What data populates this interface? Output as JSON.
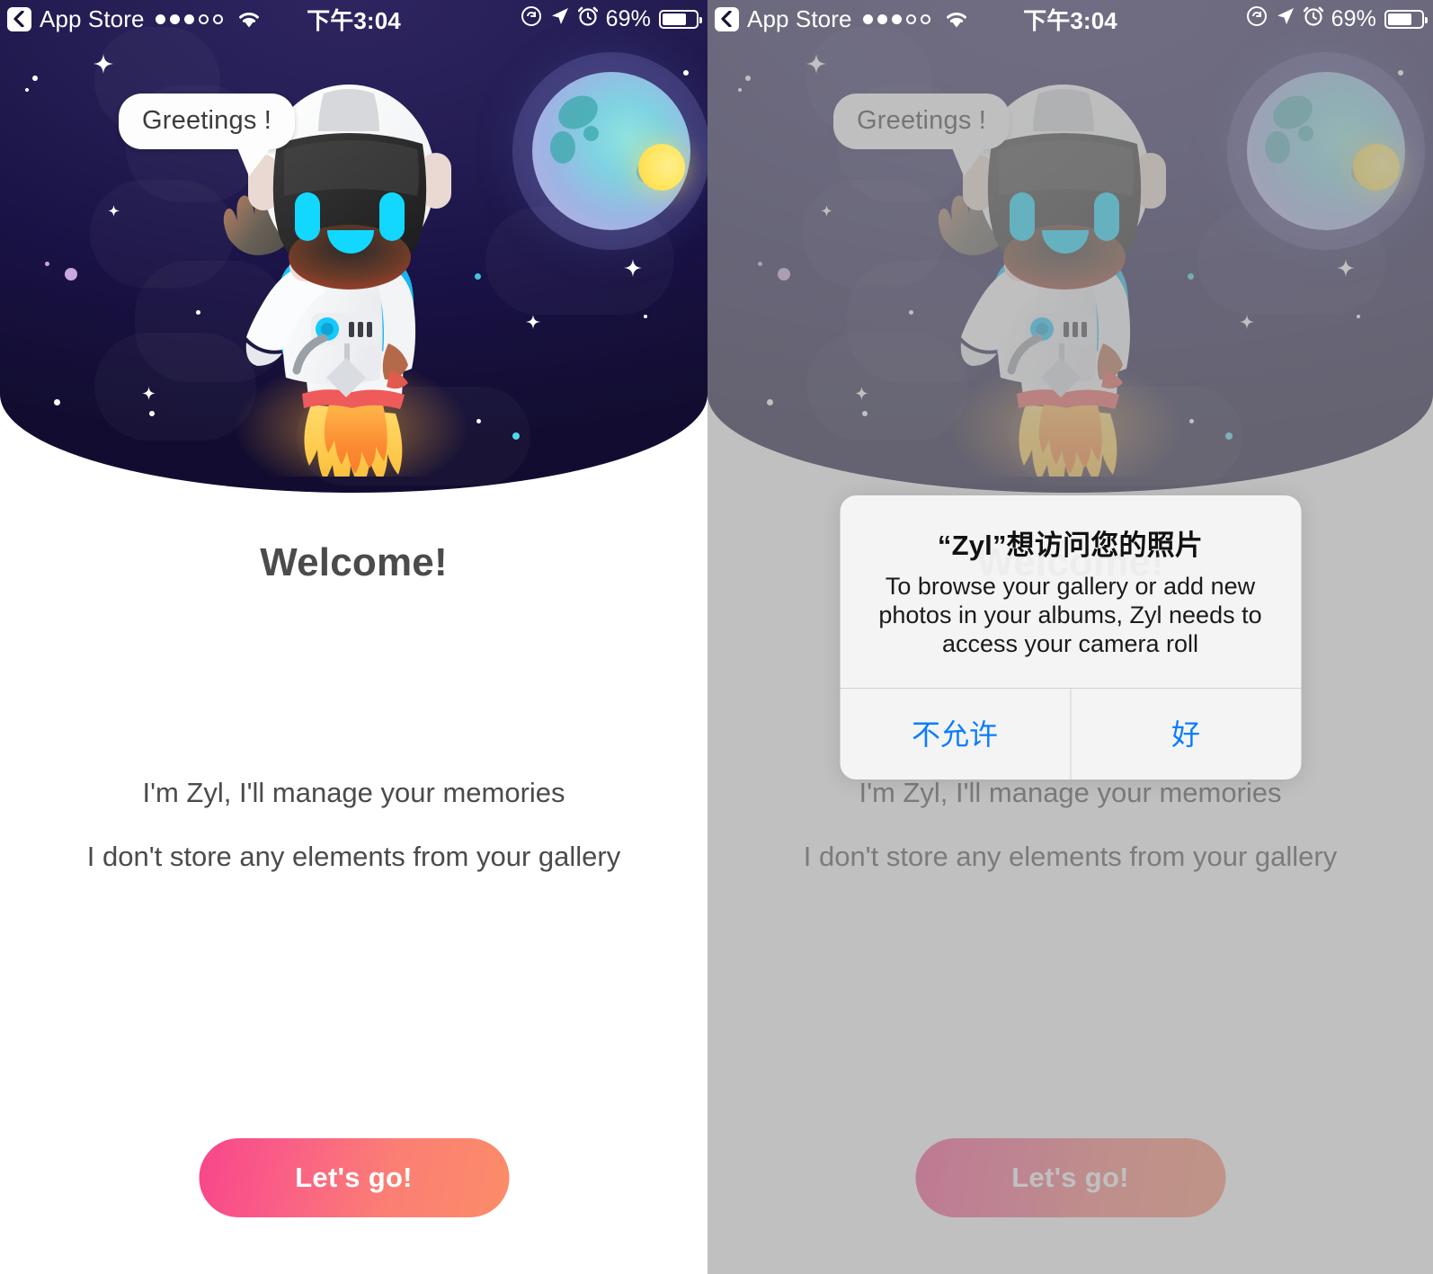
{
  "status_bar": {
    "back_icon": "back-chevron-icon",
    "carrier_label": "App Store",
    "signal_dots_filled": 3,
    "signal_dots_total": 5,
    "wifi_icon": "wifi-icon",
    "time": "下午3:04",
    "orientation_lock_icon": "rotation-lock-icon",
    "location_icon": "location-arrow-icon",
    "alarm_icon": "alarm-clock-icon",
    "battery_percent": "69%",
    "battery_icon": "battery-icon"
  },
  "hero": {
    "speech_bubble": "Greetings !",
    "astronaut_icon": "astronaut-robot-illustration",
    "planet_icon": "planet-icon",
    "moon_icon": "moon-icon",
    "sky_top_color": "#2e2560",
    "sky_bottom_color": "#120d30"
  },
  "content": {
    "title": "Welcome!",
    "line1": "I'm Zyl, I'll manage your memories",
    "line2": "I don't store any elements from your gallery",
    "cta_label": "Let's go!",
    "cta_gradient_start": "#f8468b",
    "cta_gradient_end": "#fb8c68",
    "text_color": "#4b4b4b"
  },
  "dialog": {
    "title": "“Zyl”想访问您的照片",
    "message": "To browse your gallery or add new photos in your albums, Zyl needs to access your camera roll",
    "deny_label": "不允许",
    "allow_label": "好",
    "accent_color": "#0a7cff",
    "overlay_color": "#9a9a9a"
  }
}
